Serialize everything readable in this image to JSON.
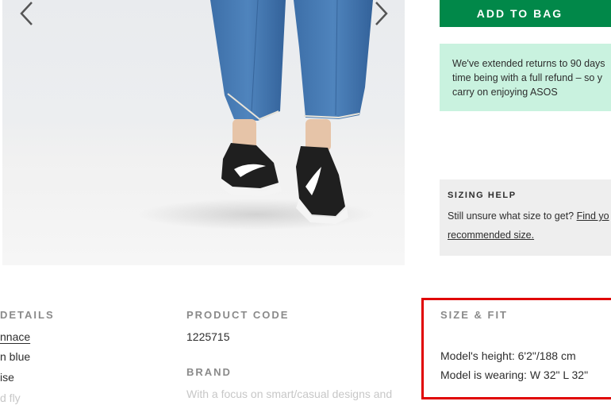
{
  "product": {
    "add_to_bag_label": "ADD TO BAG",
    "returns_message": {
      "line1": "We've extended returns to 90 days",
      "line2": "time being with a full refund – so y",
      "line3": "carry on enjoying ASOS"
    },
    "sizing_help": {
      "title": "SIZING HELP",
      "text": "Still unsure what size to get? ",
      "link_part1": "Find yo",
      "link_part2": "recommended size."
    }
  },
  "gallery": {
    "prev_icon": "chevron-left-icon",
    "next_icon": "chevron-right-icon"
  },
  "details": {
    "product_details_heading": "DETAILS",
    "lines": [
      "nnace",
      "n blue",
      "ise",
      "d fly"
    ]
  },
  "product_code": {
    "heading": "PRODUCT CODE",
    "value": "1225715"
  },
  "brand": {
    "heading": "BRAND",
    "text": "With a focus on smart/casual designs and"
  },
  "size_fit": {
    "heading": "SIZE & FIT",
    "model_height": "Model's height: 6'2\"/188 cm",
    "model_wearing": "Model is wearing: W 32\" L 32\""
  },
  "colors": {
    "accent_green": "#018849",
    "banner_mint": "#c9f2df",
    "highlight_red": "#e00000"
  }
}
